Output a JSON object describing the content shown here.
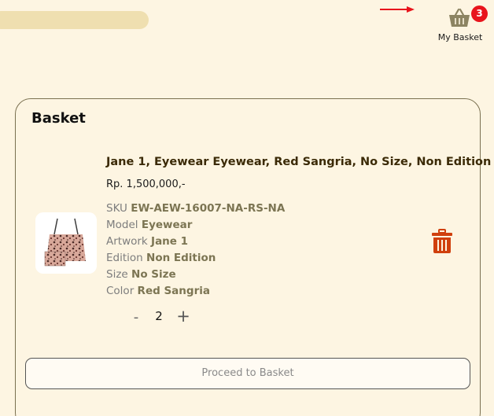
{
  "header": {
    "basket_label": "My Basket",
    "basket_count": "3",
    "badge_color": "#e8141c",
    "arrow_color": "#e8141c"
  },
  "basket": {
    "title": "Basket",
    "item": {
      "title": "Jane 1, Eyewear Eyewear, Red Sangria, No Size, Non Edition",
      "price": "Rp. 1,500,000,-",
      "attributes": [
        {
          "label": "SKU",
          "value": "EW-AEW-16007-NA-RS-NA"
        },
        {
          "label": "Model",
          "value": "Eyewear"
        },
        {
          "label": "Artwork",
          "value": "Jane 1"
        },
        {
          "label": "Edition",
          "value": "Non Edition"
        },
        {
          "label": "Size",
          "value": "No Size"
        },
        {
          "label": "Color",
          "value": "Red Sangria"
        }
      ],
      "quantity": "2",
      "qty_minus": "-",
      "qty_plus": "+",
      "image_icon": "tote-bag-image",
      "delete_icon": "trash-icon",
      "delete_color": "#d0400e"
    },
    "proceed_label": "Proceed to Basket"
  }
}
